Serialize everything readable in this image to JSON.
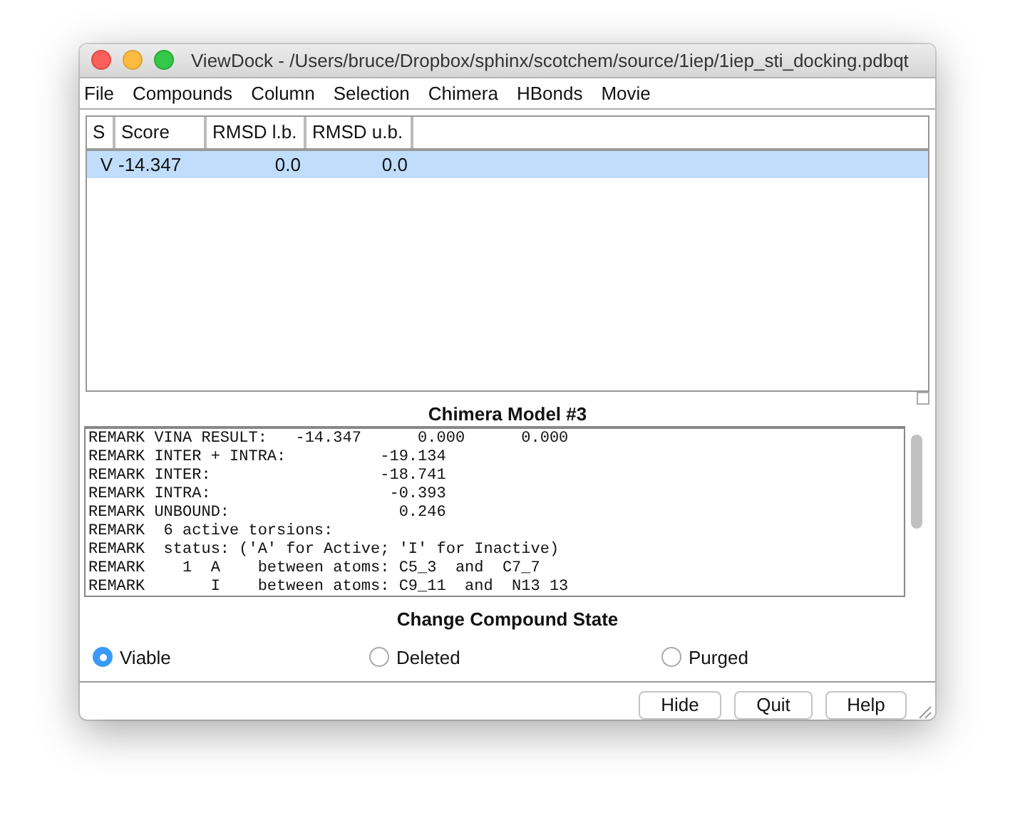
{
  "window": {
    "title": "ViewDock - /Users/bruce/Dropbox/sphinx/scotchem/source/1iep/1iep_sti_docking.pdbqt"
  },
  "menu": [
    "File",
    "Compounds",
    "Column",
    "Selection",
    "Chimera",
    "HBonds",
    "Movie"
  ],
  "table": {
    "columns": [
      "S",
      "Score",
      "RMSD l.b.",
      "RMSD u.b."
    ],
    "rows": [
      {
        "cells": [
          "V",
          "-14.347",
          "0.0",
          "0.0"
        ],
        "selected": true
      }
    ]
  },
  "details": {
    "title": "Chimera Model #3",
    "lines": [
      "REMARK VINA RESULT:   -14.347      0.000      0.000",
      "REMARK INTER + INTRA:          -19.134",
      "REMARK INTER:                  -18.741",
      "REMARK INTRA:                   -0.393",
      "REMARK UNBOUND:                  0.246",
      "REMARK  6 active torsions:",
      "REMARK  status: ('A' for Active; 'I' for Inactive)",
      "REMARK    1  A    between atoms: C5_3  and  C7_7",
      "REMARK       I    between atoms: C9_11  and  N13 13"
    ]
  },
  "state": {
    "title": "Change Compound State",
    "options": [
      {
        "label": "Viable",
        "selected": true
      },
      {
        "label": "Deleted",
        "selected": false
      },
      {
        "label": "Purged",
        "selected": false
      }
    ]
  },
  "buttons": [
    "Hide",
    "Quit",
    "Help"
  ]
}
